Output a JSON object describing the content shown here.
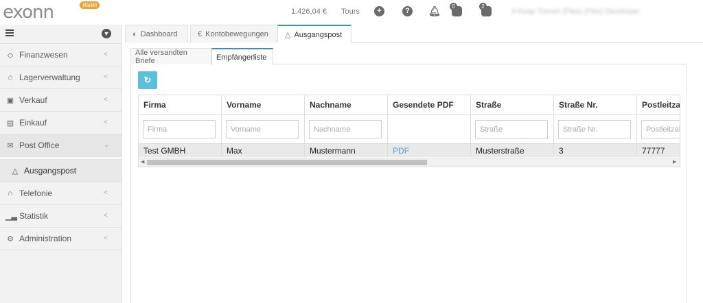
{
  "header": {
    "logo_text": "exonn",
    "logo_badge": "WaWi",
    "balance": "1.426,04 €",
    "tours": "Tours",
    "badges": [
      "0",
      "2"
    ],
    "user_menu": "ll Koop Trench (Flex) (Flex) Developer"
  },
  "sidebar": {
    "items": [
      {
        "label": "Finanzwesen",
        "icon": "diamond-icon"
      },
      {
        "label": "Lagerverwaltung",
        "icon": "warehouse-icon"
      },
      {
        "label": "Verkauf",
        "icon": "cart-icon"
      },
      {
        "label": "Einkauf",
        "icon": "truck-icon"
      },
      {
        "label": "Post Office",
        "icon": "envelope-icon"
      },
      {
        "label": "Ausgangspost",
        "icon": "outbox-icon"
      },
      {
        "label": "Telefonie",
        "icon": "headset-icon"
      },
      {
        "label": "Statistik",
        "icon": "chart-icon"
      },
      {
        "label": "Administration",
        "icon": "cogs-icon"
      }
    ]
  },
  "main_tabs": [
    {
      "label": "Dashboard",
      "icon": "dashboard-icon"
    },
    {
      "label": "Kontobewegungen",
      "icon": "euro-icon"
    },
    {
      "label": "Ausgangspost",
      "icon": "outbox-icon"
    }
  ],
  "sub_tabs": [
    {
      "label": "Alle versandten Briefe"
    },
    {
      "label": "Empfängerliste"
    }
  ],
  "table": {
    "columns": [
      "Firma",
      "Vorname",
      "Nachname",
      "Gesendete PDF",
      "Straße",
      "Straße Nr.",
      "Postleitzahl"
    ],
    "filters": [
      "Firma",
      "Vorname",
      "Nachname",
      "",
      "Straße",
      "Straße Nr.",
      "Postleitzahl"
    ],
    "rows": [
      [
        "Test GMBH",
        "Max",
        "Mustermann",
        "PDF",
        "Musterstraße",
        "3",
        "77777"
      ]
    ]
  },
  "colors": {
    "accent": "#3c8dbc",
    "refresh_button": "#5bc0de",
    "link": "#5b9bd5",
    "logo": "#3bb0c9"
  }
}
